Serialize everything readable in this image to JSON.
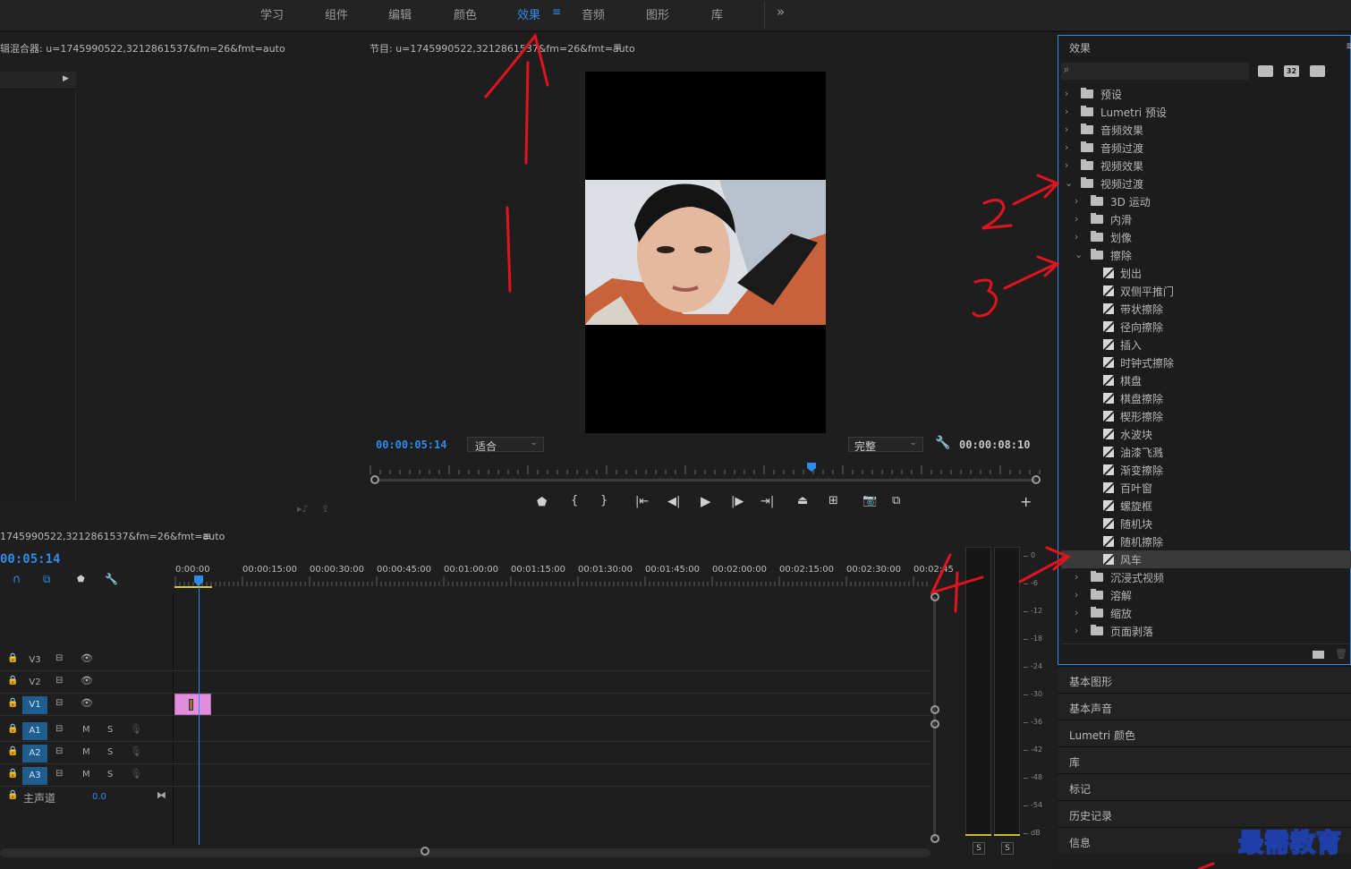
{
  "topbar": {
    "tabs": [
      {
        "label": "学习"
      },
      {
        "label": "组件"
      },
      {
        "label": "编辑"
      },
      {
        "label": "颜色"
      },
      {
        "label": "效果"
      },
      {
        "label": "音频"
      },
      {
        "label": "图形"
      },
      {
        "label": "库"
      }
    ],
    "more": "»"
  },
  "mixer": {
    "title": "辑混合器: u=1745990522,3212861537&fm=26&fmt=auto"
  },
  "program": {
    "title": "节目: u=1745990522,3212861537&fm=26&fmt=auto",
    "timecode": "00:00:05:14",
    "fit": "适合",
    "quality": "完整",
    "duration": "00:00:08:10"
  },
  "effects": {
    "title": "效果",
    "search_placeholder": "",
    "badges": [
      "32"
    ],
    "items": [
      {
        "label": "预设",
        "type": "folder",
        "level": 0
      },
      {
        "label": "Lumetri 预设",
        "type": "folder",
        "level": 0
      },
      {
        "label": "音频效果",
        "type": "folder",
        "level": 0
      },
      {
        "label": "音频过渡",
        "type": "folder",
        "level": 0
      },
      {
        "label": "视频效果",
        "type": "folder",
        "level": 0
      },
      {
        "label": "视频过渡",
        "type": "folder",
        "level": 0
      },
      {
        "label": "3D 运动",
        "type": "folder",
        "level": 1
      },
      {
        "label": "内滑",
        "type": "folder",
        "level": 1
      },
      {
        "label": "划像",
        "type": "folder",
        "level": 1
      },
      {
        "label": "擦除",
        "type": "folder",
        "level": 1
      },
      {
        "label": "划出",
        "type": "fx",
        "level": 2
      },
      {
        "label": "双侧平推门",
        "type": "fx",
        "level": 2
      },
      {
        "label": "带状擦除",
        "type": "fx",
        "level": 2
      },
      {
        "label": "径向擦除",
        "type": "fx",
        "level": 2
      },
      {
        "label": "插入",
        "type": "fx",
        "level": 2
      },
      {
        "label": "时钟式擦除",
        "type": "fx",
        "level": 2
      },
      {
        "label": "棋盘",
        "type": "fx",
        "level": 2
      },
      {
        "label": "棋盘擦除",
        "type": "fx",
        "level": 2
      },
      {
        "label": "楔形擦除",
        "type": "fx",
        "level": 2
      },
      {
        "label": "水波块",
        "type": "fx",
        "level": 2
      },
      {
        "label": "油漆飞溅",
        "type": "fx",
        "level": 2
      },
      {
        "label": "渐变擦除",
        "type": "fx",
        "level": 2
      },
      {
        "label": "百叶窗",
        "type": "fx",
        "level": 2
      },
      {
        "label": "螺旋框",
        "type": "fx",
        "level": 2
      },
      {
        "label": "随机块",
        "type": "fx",
        "level": 2
      },
      {
        "label": "随机擦除",
        "type": "fx",
        "level": 2
      },
      {
        "label": "风车",
        "type": "fx",
        "level": 2,
        "selected": true
      },
      {
        "label": "沉浸式视频",
        "type": "folder",
        "level": 1
      },
      {
        "label": "溶解",
        "type": "folder",
        "level": 1
      },
      {
        "label": "缩放",
        "type": "folder",
        "level": 1
      },
      {
        "label": "页面剥落",
        "type": "folder",
        "level": 1
      }
    ]
  },
  "side_panels": [
    "基本图形",
    "基本声音",
    "Lumetri 颜色",
    "库",
    "标记",
    "历史记录",
    "信息"
  ],
  "timeline": {
    "title": "1745990522,3212861537&fm=26&fmt=auto",
    "timecode": "00:05:14",
    "ruler": [
      "0:00:00",
      "00:00:15:00",
      "00:00:30:00",
      "00:00:45:00",
      "00:01:00:00",
      "00:01:15:00",
      "00:01:30:00",
      "00:01:45:00",
      "00:02:00:00",
      "00:02:15:00",
      "00:02:30:00",
      "00:02:45:"
    ],
    "video_tracks": [
      "V3",
      "V2",
      "V1"
    ],
    "audio_tracks": [
      "A1",
      "A2",
      "A3"
    ],
    "master_label": "主声道",
    "master_value": "0.0",
    "m_label": "M",
    "s_label": "S"
  },
  "meter": {
    "scale": [
      "0",
      "-6",
      "-12",
      "-18",
      "-24",
      "-30",
      "-36",
      "-42",
      "-48",
      "-54",
      "dB"
    ],
    "solo": [
      "S",
      "S"
    ]
  },
  "annotations": [
    "1",
    "2",
    "3",
    "4"
  ],
  "watermark": "最需教育",
  "colors": {
    "accent": "#2d8ceb",
    "clip": "#e38de0",
    "panel": "#1e1e1e",
    "annotation": "#e0141e"
  }
}
